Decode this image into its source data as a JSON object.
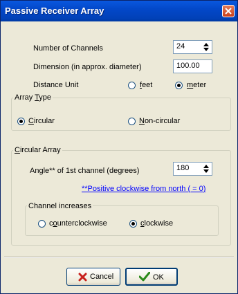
{
  "window": {
    "title": "Passive Receiver Array"
  },
  "settings": {
    "channels_label": "Number of Channels",
    "channels_value": "24",
    "dimension_label": "Dimension (in approx. diameter)",
    "dimension_value": "100.00",
    "unit_label": "Distance Unit",
    "unit_options": [
      {
        "label": "feet",
        "selected": false
      },
      {
        "label": "meter",
        "selected": true
      }
    ]
  },
  "array_type": {
    "title": "Array Type",
    "options": [
      {
        "label": "Circular",
        "selected": true
      },
      {
        "label": "Non-circular",
        "selected": false
      }
    ]
  },
  "circular_array": {
    "title": "Circular Array",
    "angle_label": "Angle** of 1st channel (degrees)",
    "angle_value": "180",
    "note": "**Positive clockwise from north ( = 0)",
    "channel_increases": {
      "title": "Channel increases",
      "options": [
        {
          "label": "counterclockwise",
          "selected": false
        },
        {
          "label": "clockwise",
          "selected": true
        }
      ]
    }
  },
  "buttons": {
    "cancel": "Cancel",
    "ok": "OK"
  },
  "icons": {
    "close": "close-icon",
    "cancel": "x-icon",
    "ok": "check-icon",
    "spinner": "spin-arrows-icon"
  },
  "colors": {
    "title_bar": "#0348c9",
    "close_button": "#c9401c",
    "dialog_bg": "#ece9d8",
    "link": "#0000ff"
  }
}
